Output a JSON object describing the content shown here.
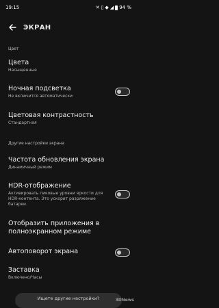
{
  "status_bar": {
    "time": "19:15",
    "battery_percent": "94 %",
    "icons": [
      "mute-icon",
      "vibrate-icon",
      "wifi-icon",
      "signal-icon",
      "battery-icon"
    ]
  },
  "header": {
    "title": "ЭКРАН",
    "back_icon": "arrow-left-icon"
  },
  "sections": {
    "color_header": "Цвет",
    "other_header": "Другие настройки экрана"
  },
  "settings": {
    "colors": {
      "title": "Цвета",
      "subtitle": "Насыщенные"
    },
    "night_light": {
      "title": "Ночная подсветка",
      "subtitle": "Не включится автоматически",
      "toggle_on": false
    },
    "color_contrast": {
      "title": "Цветовая контрастность",
      "subtitle": "Стандартная"
    },
    "refresh_rate": {
      "title": "Частота обновления экрана",
      "subtitle": "Динамичный режим"
    },
    "hdr": {
      "title": "HDR-отображение",
      "subtitle": "Активировать пиковые уровни яркости для HDR-контента. Это ускорит разряжение батареи.",
      "toggle_on": false
    },
    "fullscreen_apps": {
      "title": "Отобразить приложения в полноэкранном режиме"
    },
    "auto_rotate": {
      "title": "Автоповорот экрана",
      "toggle_on": false
    },
    "screensaver": {
      "title": "Заставка",
      "subtitle": "Включено/Часы"
    }
  },
  "search": {
    "label": "Ищете другие настройки?"
  },
  "watermark": "3DNews"
}
